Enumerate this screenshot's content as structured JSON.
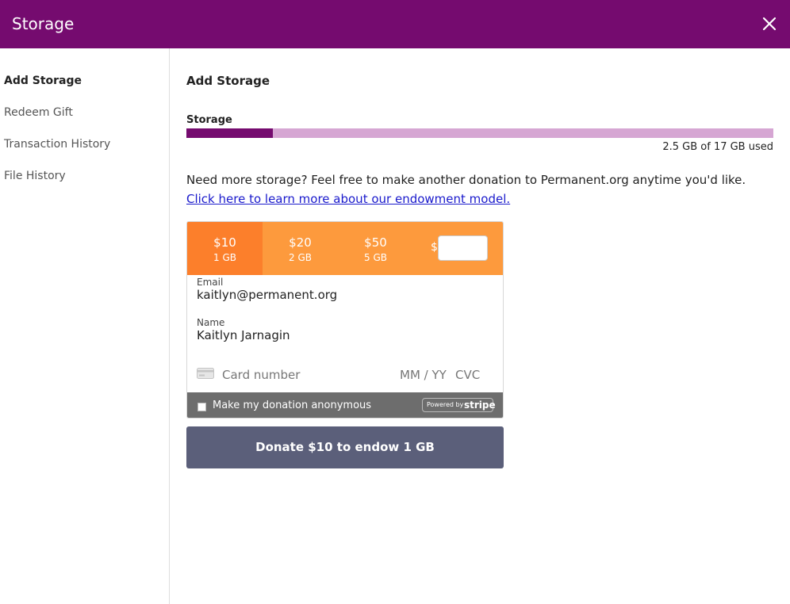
{
  "header": {
    "title": "Storage",
    "close_icon": "close-icon"
  },
  "sidebar": {
    "items": [
      {
        "label": "Add Storage",
        "active": true
      },
      {
        "label": "Redeem Gift"
      },
      {
        "label": "Transaction History"
      },
      {
        "label": "File History"
      }
    ]
  },
  "main": {
    "heading": "Add Storage",
    "storage_label": "Storage",
    "usage": {
      "used_fraction": 0.147,
      "text": "2.5 GB of 17 GB used"
    },
    "description": "Need more storage? Feel free to make another donation to Permanent.org anytime you'd like.",
    "learn_more": "Click here to learn more about our endowment model."
  },
  "donation": {
    "amounts": [
      {
        "value": "$10",
        "gb": "1 GB",
        "selected": true
      },
      {
        "value": "$20",
        "gb": "2 GB"
      },
      {
        "value": "$50",
        "gb": "5 GB"
      }
    ],
    "custom_prefix": "$",
    "email": {
      "label": "Email",
      "value": "kaitlyn@permanent.org"
    },
    "name": {
      "label": "Name",
      "value": "Kaitlyn Jarnagin"
    },
    "card": {
      "number_placeholder": "Card number",
      "expiry_placeholder": "MM / YY",
      "cvc_placeholder": "CVC"
    },
    "anonymous_label": "Make my donation anonymous",
    "stripe_badge": {
      "prefix": "Powered by",
      "brand": "stripe"
    },
    "submit_label": "Donate $10 to endow 1 GB"
  },
  "colors": {
    "header_bg": "#750b6f",
    "bar_fill": "#750b6f",
    "bar_track": "#d6a6d3",
    "amount_bg": "#fd9a3d",
    "amount_selected": "#fc7f2b",
    "donate_btn": "#5b5f7a"
  }
}
